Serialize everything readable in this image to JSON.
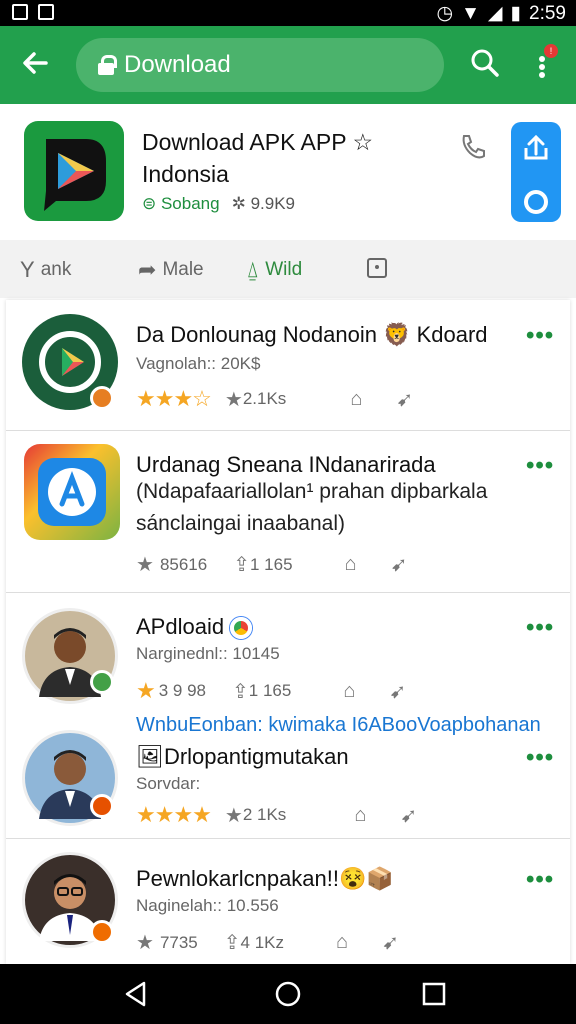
{
  "status_bar": {
    "time": "2:59"
  },
  "app_bar": {
    "back_icon": "arrow-left-icon",
    "url_text": "Download",
    "badge": "!"
  },
  "app_header": {
    "title": "Download APK APP ☆ Indonsia",
    "developer": "Sobang",
    "size": "9.9K9"
  },
  "tabs": [
    {
      "label": "ank",
      "icon": "Y"
    },
    {
      "label": "Male",
      "icon": "share-arrow-icon"
    },
    {
      "label": "Wild",
      "icon": "leaf-icon"
    },
    {
      "label": "",
      "icon": "bookmark-square-icon"
    }
  ],
  "items": [
    {
      "title": "Da Donlounag Nodanoin 🦁 Kdoard",
      "sub": "Vagnolah:: 20K$",
      "stars": "★★★☆",
      "stat1": "2.1Ks",
      "stat2": ""
    },
    {
      "title": "Urdanag Sneana INdanarirada",
      "desc": "(Ndapafaariallolan¹ prahan dipbarkala sánclaingai inaabanal)",
      "stat1": "85616",
      "stat2": "1 165"
    },
    {
      "title": "APdloaid",
      "sub": "Narginednl:: 10145",
      "stat1": "3 9 98",
      "stat2": "1 165"
    },
    {
      "link": "WnbuEonban: kwimaka I6ABooVoapbohanan",
      "title": "Drlopantigmutakan",
      "sub": "Sorvdar:",
      "stars": "★★★★",
      "stat1": "2 1Ks"
    },
    {
      "title": "Pewnlokarlcnpakan!!",
      "sub": "Naginelah:: 10.556",
      "stat1": "7735",
      "stat2": "4 1Kz"
    }
  ],
  "more_label": "•••",
  "colors": {
    "accent_green": "#22a04d",
    "dark_green": "#1e8e3e",
    "star": "#f5a623",
    "blue": "#2196f3"
  }
}
